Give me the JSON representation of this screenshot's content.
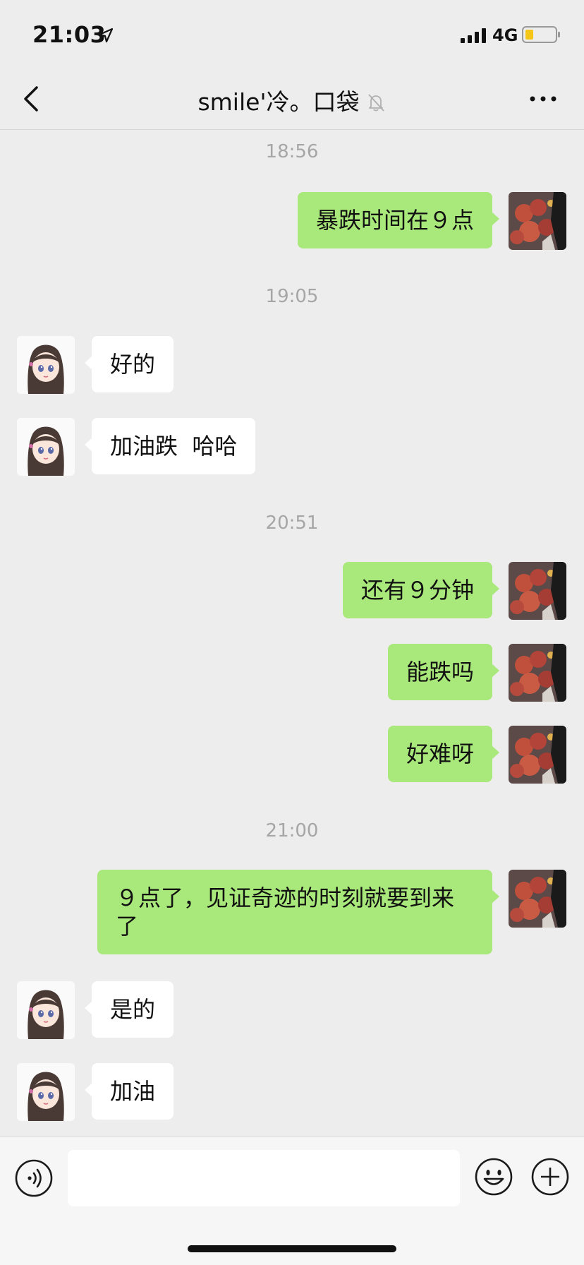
{
  "status_bar": {
    "time": "21:03",
    "network": "4G",
    "icons": [
      "location-arrow-icon",
      "signal-icon",
      "battery-icon"
    ]
  },
  "nav": {
    "title": "smile'冷。口袋",
    "icons": [
      "back-chevron-icon",
      "mute-bell-icon",
      "more-icon"
    ]
  },
  "messages": [
    {
      "type": "time",
      "text": "18:56"
    },
    {
      "type": "msg",
      "sender": "me",
      "text": "暴跌时间在９点"
    },
    {
      "type": "time",
      "text": "19:05"
    },
    {
      "type": "msg",
      "sender": "other",
      "text": "好的"
    },
    {
      "type": "msg",
      "sender": "other",
      "text": "加油跌  哈哈"
    },
    {
      "type": "time",
      "text": "20:51"
    },
    {
      "type": "msg",
      "sender": "me",
      "text": "还有９分钟"
    },
    {
      "type": "msg",
      "sender": "me",
      "text": "能跌吗"
    },
    {
      "type": "msg",
      "sender": "me",
      "text": "好难呀"
    },
    {
      "type": "time",
      "text": "21:00"
    },
    {
      "type": "msg",
      "sender": "me",
      "text": "９点了，见证奇迹的时刻就要到来了"
    },
    {
      "type": "msg",
      "sender": "other",
      "text": "是的"
    },
    {
      "type": "msg",
      "sender": "other",
      "text": "加油"
    }
  ],
  "input_bar": {
    "value": "",
    "placeholder": "",
    "icons": [
      "voice-icon",
      "emoji-icon",
      "plus-icon"
    ]
  },
  "colors": {
    "background": "#ededed",
    "my_bubble": "#a9e87a",
    "other_bubble": "#ffffff",
    "timestamp_text": "#a6a6a6"
  }
}
